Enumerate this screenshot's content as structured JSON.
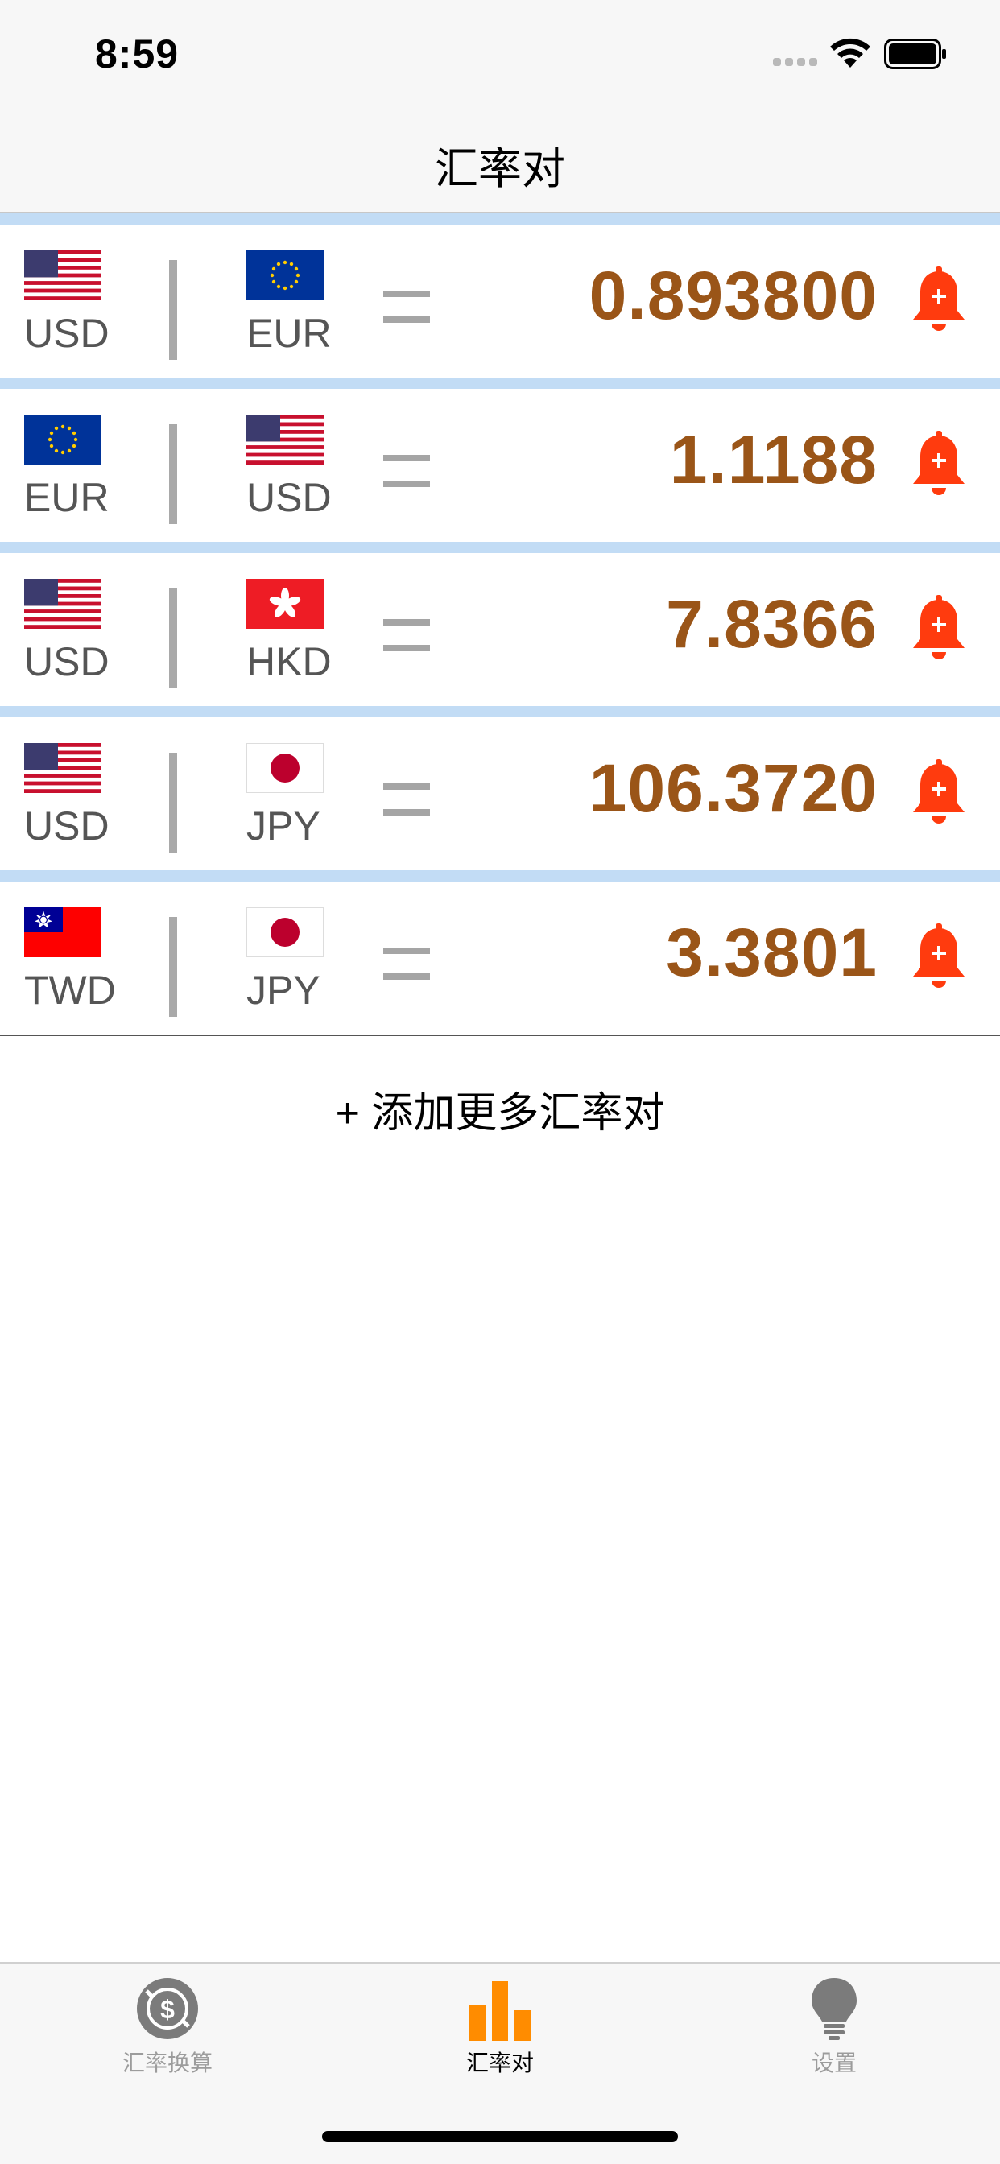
{
  "status_bar": {
    "time": "8:59"
  },
  "nav": {
    "title": "汇率对"
  },
  "colors": {
    "rate_text": "#9a5518",
    "bell": "#ff3b0e",
    "row_separator": "#c2dcf5",
    "active_tab": "#ff8c00"
  },
  "pairs": [
    {
      "from": "USD",
      "to": "EUR",
      "rate": "0.893800",
      "from_flag": "us-flag-icon",
      "to_flag": "eu-flag-icon"
    },
    {
      "from": "EUR",
      "to": "USD",
      "rate": "1.1188",
      "from_flag": "eu-flag-icon",
      "to_flag": "us-flag-icon"
    },
    {
      "from": "USD",
      "to": "HKD",
      "rate": "7.8366",
      "from_flag": "us-flag-icon",
      "to_flag": "hk-flag-icon"
    },
    {
      "from": "USD",
      "to": "JPY",
      "rate": "106.3720",
      "from_flag": "us-flag-icon",
      "to_flag": "jp-flag-icon"
    },
    {
      "from": "TWD",
      "to": "JPY",
      "rate": "3.3801",
      "from_flag": "tw-flag-icon",
      "to_flag": "jp-flag-icon"
    }
  ],
  "add_more_label": "+ 添加更多汇率对",
  "tabs": [
    {
      "label": "汇率换算",
      "icon": "currency-exchange-icon",
      "active": false
    },
    {
      "label": "汇率对",
      "icon": "bar-chart-icon",
      "active": true
    },
    {
      "label": "设置",
      "icon": "lightbulb-icon",
      "active": false
    }
  ]
}
